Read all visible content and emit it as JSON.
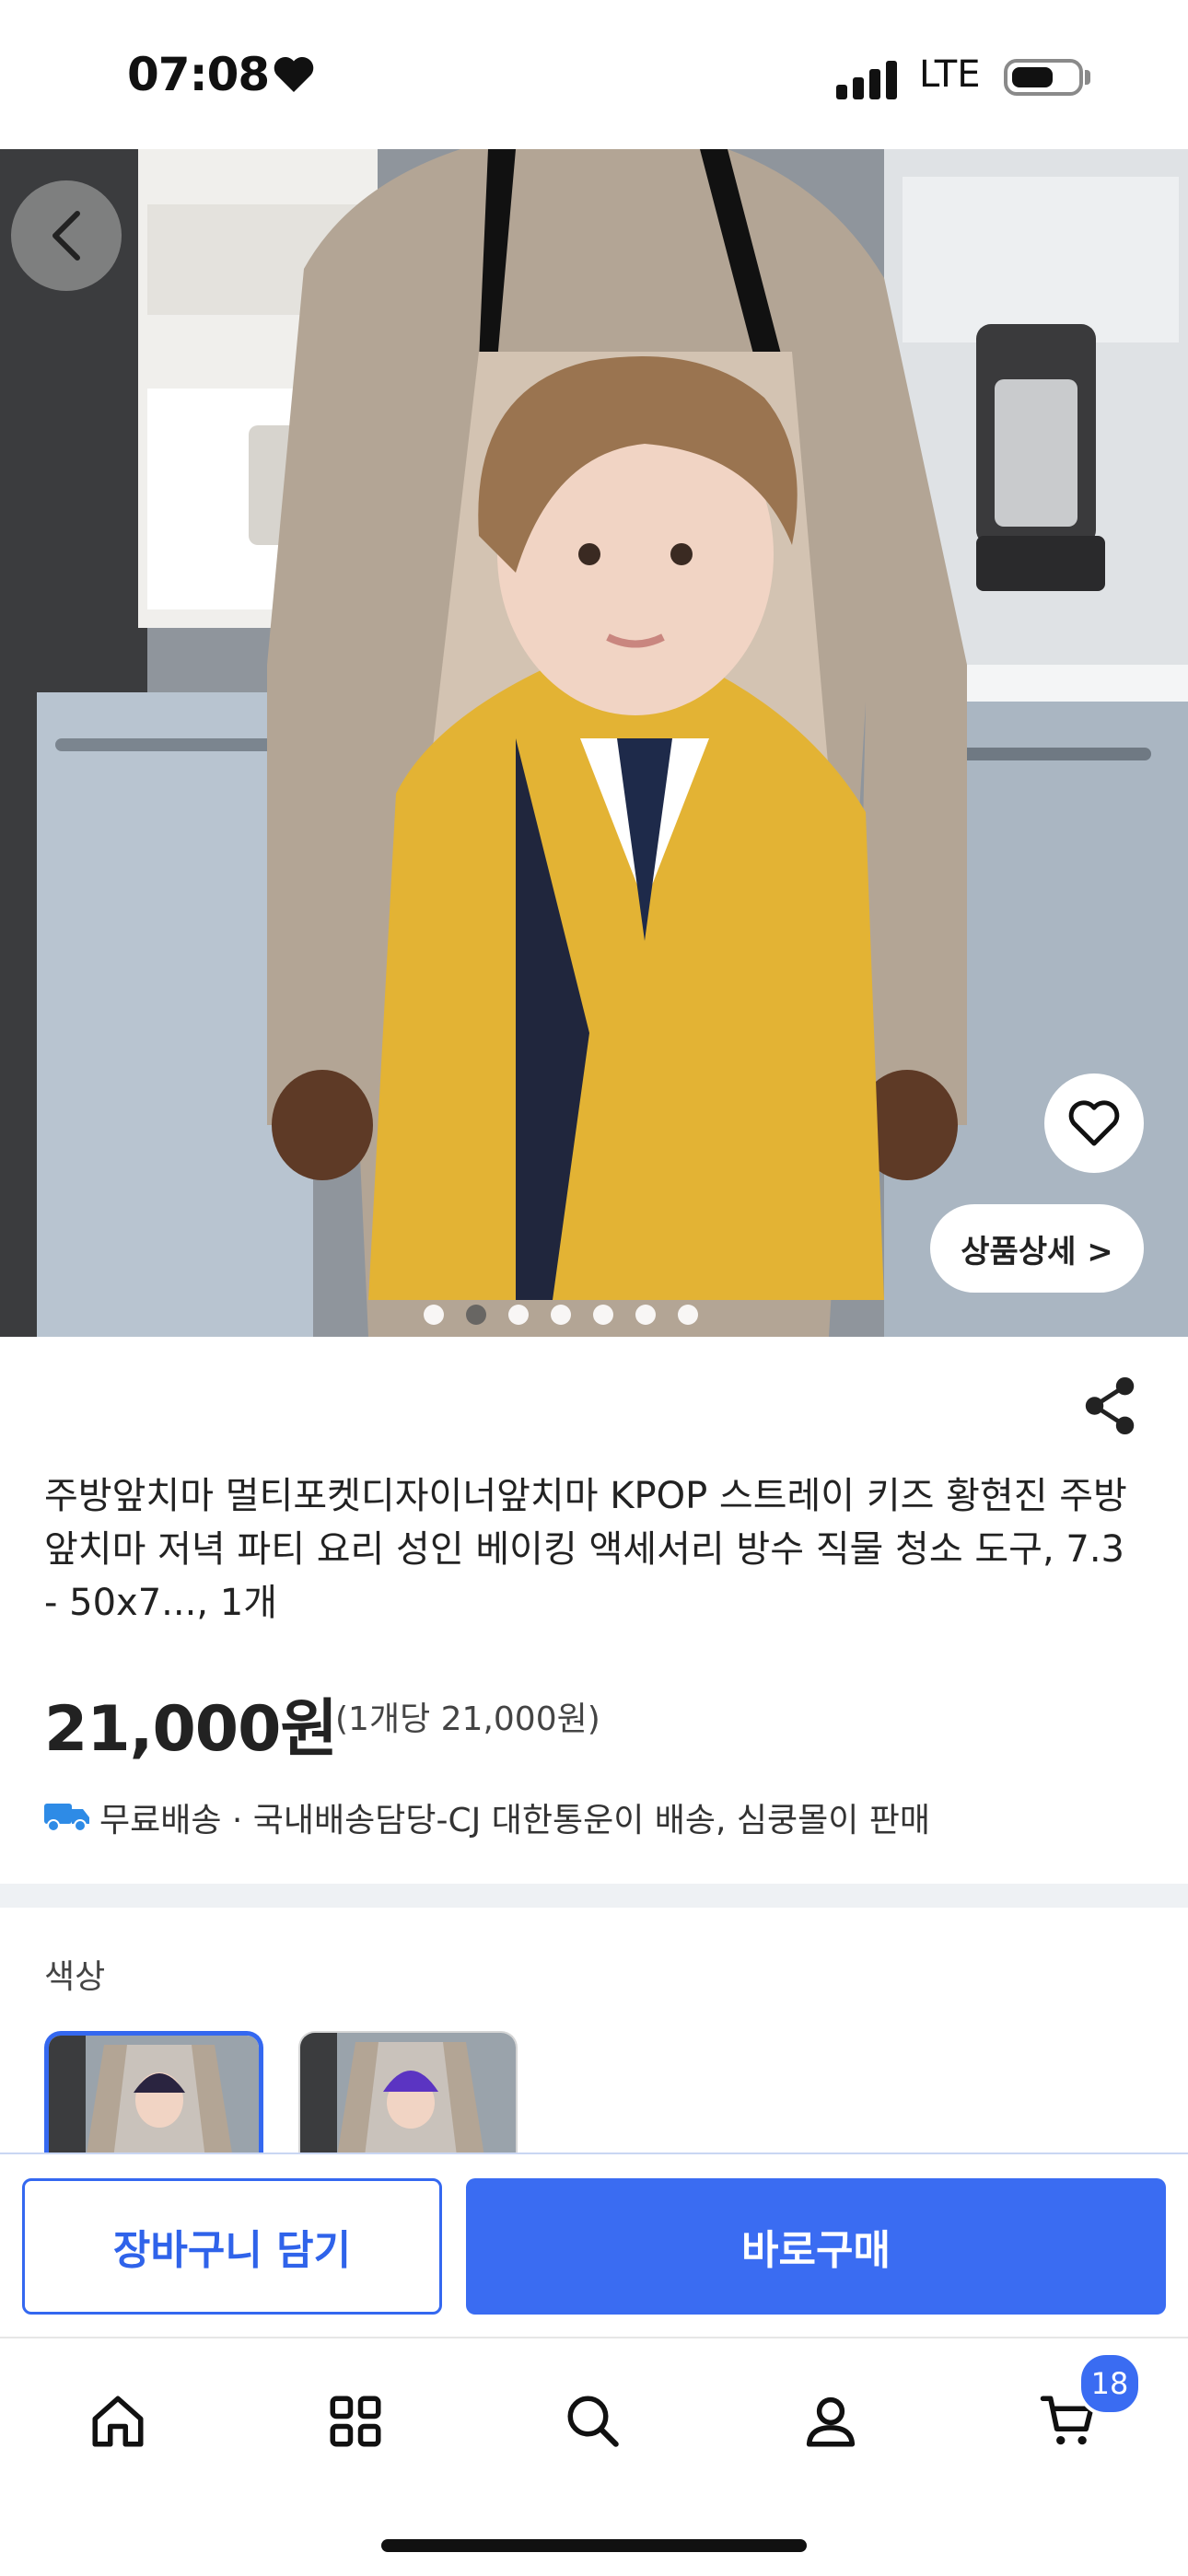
{
  "status_bar": {
    "time": "07:08",
    "network": "LTE",
    "battery_level": 0.65,
    "signal_bars": 4
  },
  "hero": {
    "image_count": 7,
    "active_index": 1,
    "detail_button_label": "상품상세 >",
    "icons": [
      "back-icon",
      "heart-icon"
    ]
  },
  "product": {
    "title": "주방앞치마 멀티포켓디자이너앞치마 KPOP 스트레이 키즈 황현진 주방 앞치마 저녁 파티 요리 성인 베이킹 액세서리 방수 직물 청소 도구, 7.3 - 50x7..., 1개",
    "price": "21,000원",
    "unit_price": "(1개당 21,000원)",
    "shipping": "무료배송 · 국내배송담당-CJ 대한통운이 배송, 심쿵몰이 판매"
  },
  "options": {
    "label": "색상",
    "selected_index": 0,
    "swatch_count": 2
  },
  "actions": {
    "cart_label": "장바구니 담기",
    "buy_label": "바로구매"
  },
  "nav": {
    "items": [
      "home-icon",
      "categories-icon",
      "search-icon",
      "profile-icon",
      "cart-icon"
    ],
    "cart_badge": "18"
  },
  "colors": {
    "accent": "#3A6CF2",
    "truck": "#2E8BE6"
  }
}
